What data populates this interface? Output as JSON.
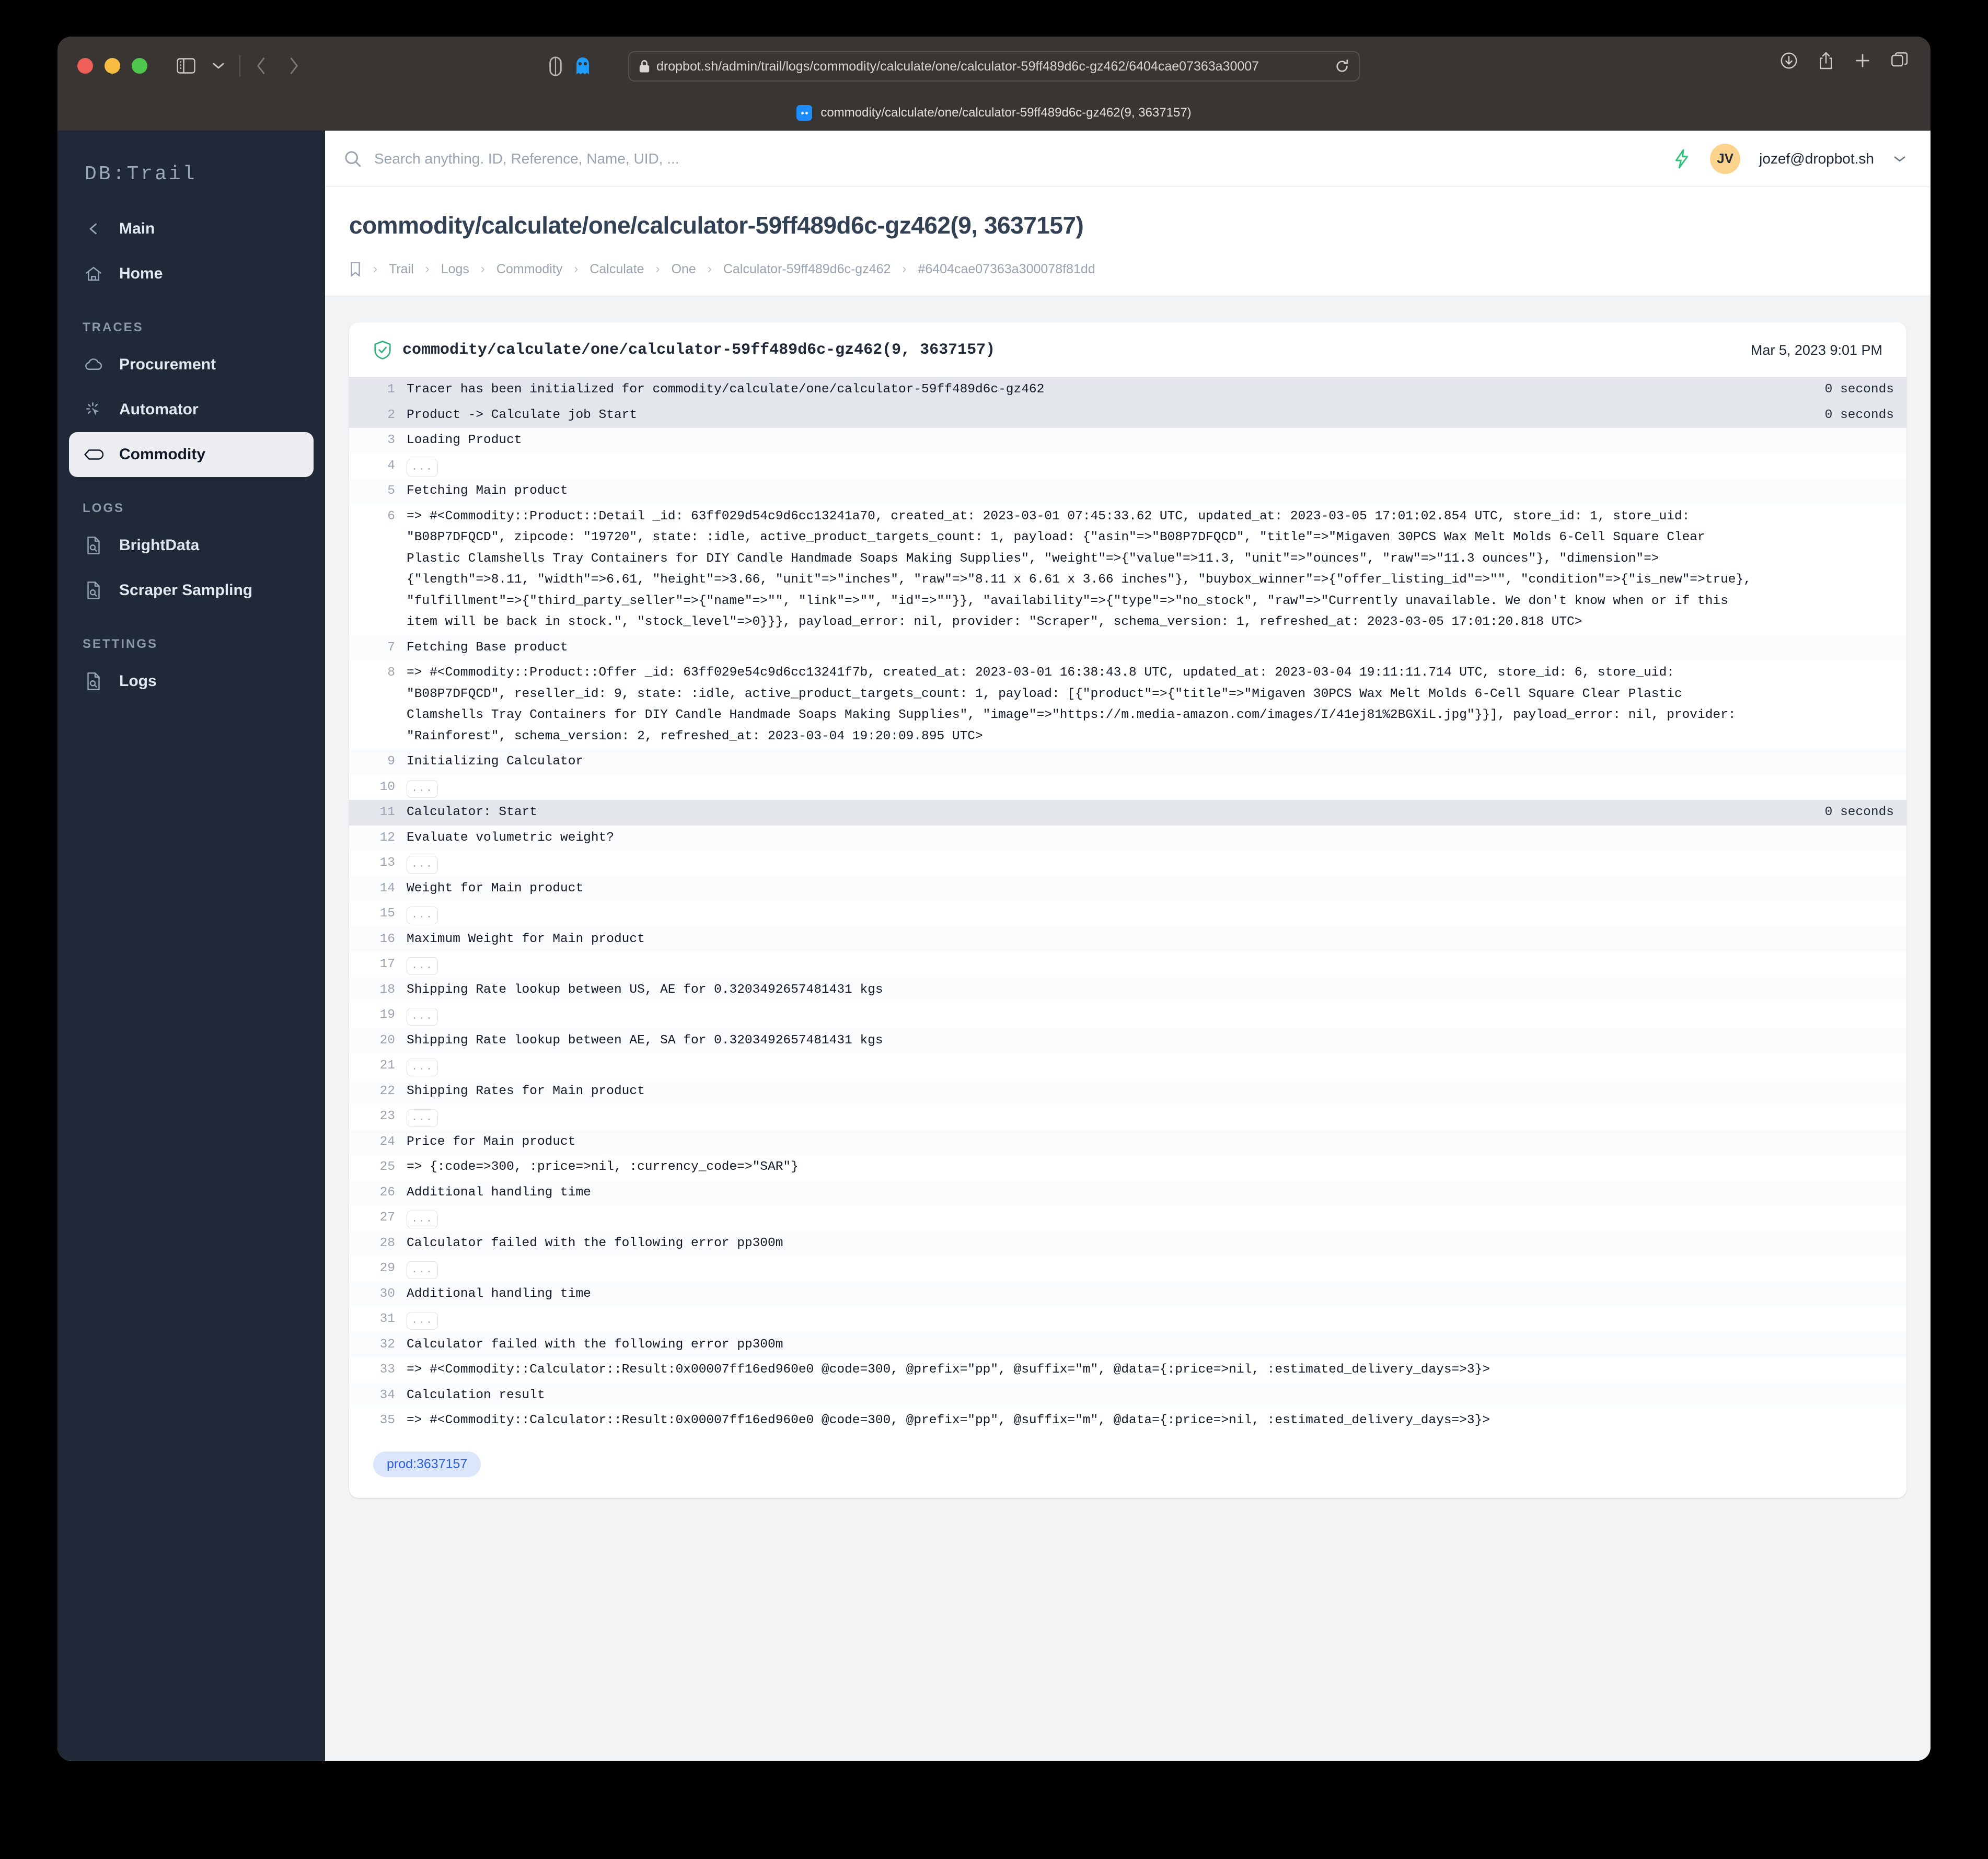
{
  "browser": {
    "url": "dropbot.sh/admin/trail/logs/commodity/calculate/one/calculator-59ff489d6c-gz462/6404cae07363a30007",
    "tab_title": "commodity/calculate/one/calculator-59ff489d6c-gz462(9, 3637157)"
  },
  "sidebar": {
    "brand": "DB:Trail",
    "top_items": [
      {
        "label": "Main",
        "icon": "chevron-left-icon"
      },
      {
        "label": "Home",
        "icon": "home-icon"
      }
    ],
    "sections": [
      {
        "title": "TRACES",
        "items": [
          {
            "label": "Procurement",
            "icon": "cloud-icon",
            "active": false
          },
          {
            "label": "Automator",
            "icon": "cursor-click-icon",
            "active": false
          },
          {
            "label": "Commodity",
            "icon": "tag-icon",
            "active": true
          }
        ]
      },
      {
        "title": "LOGS",
        "items": [
          {
            "label": "BrightData",
            "icon": "document-search-icon",
            "active": false
          },
          {
            "label": "Scraper Sampling",
            "icon": "document-search-icon",
            "active": false
          }
        ]
      },
      {
        "title": "SETTINGS",
        "items": [
          {
            "label": "Logs",
            "icon": "document-search-icon",
            "active": false
          }
        ]
      }
    ]
  },
  "topbar": {
    "search_placeholder": "Search anything. ID, Reference, Name, UID, ...",
    "search_value": "",
    "user_initials": "JV",
    "user_email": "jozef@dropbot.sh"
  },
  "header": {
    "title": "commodity/calculate/one/calculator-59ff489d6c-gz462(9, 3637157)",
    "breadcrumb": [
      "Trail",
      "Logs",
      "Commodity",
      "Calculate",
      "One",
      "Calculator-59ff489d6c-gz462",
      "#6404cae07363a300078f81dd"
    ]
  },
  "card": {
    "title": "commodity/calculate/one/calculator-59ff489d6c-gz462(9, 3637157)",
    "date": "Mar 5, 2023 9:01 PM",
    "status_icon": "shield-check-icon",
    "tag": "prod:3637157",
    "lines": [
      {
        "n": "1",
        "text": "Tracer has been initialized for commodity/calculate/one/calculator-59ff489d6c-gz462",
        "dur": "0 seconds",
        "highlight": true
      },
      {
        "n": "2",
        "text": "Product -> Calculate job Start",
        "dur": "0 seconds",
        "highlight": true
      },
      {
        "n": "3",
        "text": "Loading Product",
        "dur": ""
      },
      {
        "n": "4",
        "text": "...",
        "dur": "",
        "collapsed": true
      },
      {
        "n": "5",
        "text": "Fetching Main product",
        "dur": ""
      },
      {
        "n": "6",
        "text": "=> #<Commodity::Product::Detail _id: 63ff029d54c9d6cc13241a70, created_at: 2023-03-01 07:45:33.62 UTC, updated_at: 2023-03-05 17:01:02.854 UTC, store_id: 1, store_uid: \"B08P7DFQCD\", zipcode: \"19720\", state: :idle, active_product_targets_count: 1, payload: {\"asin\"=>\"B08P7DFQCD\", \"title\"=>\"Migaven 30PCS Wax Melt Molds 6-Cell Square Clear Plastic Clamshells Tray Containers for DIY Candle Handmade Soaps Making Supplies\", \"weight\"=>{\"value\"=>11.3, \"unit\"=>\"ounces\", \"raw\"=>\"11.3 ounces\"}, \"dimension\"=>{\"length\"=>8.11, \"width\"=>6.61, \"height\"=>3.66, \"unit\"=>\"inches\", \"raw\"=>\"8.11 x 6.61 x 3.66 inches\"}, \"buybox_winner\"=>{\"offer_listing_id\"=>\"\", \"condition\"=>{\"is_new\"=>true}, \"fulfillment\"=>{\"third_party_seller\"=>{\"name\"=>\"\", \"link\"=>\"\", \"id\"=>\"\"}}, \"availability\"=>{\"type\"=>\"no_stock\", \"raw\"=>\"Currently unavailable. We don't know when or if this item will be back in stock.\", \"stock_level\"=>0}}}, payload_error: nil, provider: \"Scraper\", schema_version: 1, refreshed_at: 2023-03-05 17:01:20.818 UTC>",
        "dur": ""
      },
      {
        "n": "7",
        "text": "Fetching Base product",
        "dur": ""
      },
      {
        "n": "8",
        "text": "=> #<Commodity::Product::Offer _id: 63ff029e54c9d6cc13241f7b, created_at: 2023-03-01 16:38:43.8 UTC, updated_at: 2023-03-04 19:11:11.714 UTC, store_id: 6, store_uid: \"B08P7DFQCD\", reseller_id: 9, state: :idle, active_product_targets_count: 1, payload: [{\"product\"=>{\"title\"=>\"Migaven 30PCS Wax Melt Molds 6-Cell Square Clear Plastic Clamshells Tray Containers for DIY Candle Handmade Soaps Making Supplies\", \"image\"=>\"https://m.media-amazon.com/images/I/41ej81%2BGXiL.jpg\"}}], payload_error: nil, provider: \"Rainforest\", schema_version: 2, refreshed_at: 2023-03-04 19:20:09.895 UTC>",
        "dur": ""
      },
      {
        "n": "9",
        "text": "Initializing Calculator",
        "dur": ""
      },
      {
        "n": "10",
        "text": "...",
        "dur": "",
        "collapsed": true
      },
      {
        "n": "11",
        "text": "Calculator: Start",
        "dur": "0 seconds",
        "highlight": true
      },
      {
        "n": "12",
        "text": "Evaluate volumetric weight?",
        "dur": ""
      },
      {
        "n": "13",
        "text": "...",
        "dur": "",
        "collapsed": true
      },
      {
        "n": "14",
        "text": "Weight for Main product",
        "dur": ""
      },
      {
        "n": "15",
        "text": "...",
        "dur": "",
        "collapsed": true
      },
      {
        "n": "16",
        "text": "Maximum Weight for Main product",
        "dur": ""
      },
      {
        "n": "17",
        "text": "...",
        "dur": "",
        "collapsed": true
      },
      {
        "n": "18",
        "text": "Shipping Rate lookup between US, AE for 0.3203492657481431 kgs",
        "dur": ""
      },
      {
        "n": "19",
        "text": "...",
        "dur": "",
        "collapsed": true
      },
      {
        "n": "20",
        "text": "Shipping Rate lookup between AE, SA for 0.3203492657481431 kgs",
        "dur": ""
      },
      {
        "n": "21",
        "text": "...",
        "dur": "",
        "collapsed": true
      },
      {
        "n": "22",
        "text": "Shipping Rates for Main product",
        "dur": ""
      },
      {
        "n": "23",
        "text": "...",
        "dur": "",
        "collapsed": true
      },
      {
        "n": "24",
        "text": "Price for Main product",
        "dur": ""
      },
      {
        "n": "25",
        "text": "=> {:code=>300, :price=>nil, :currency_code=>\"SAR\"}",
        "dur": ""
      },
      {
        "n": "26",
        "text": "Additional handling time",
        "dur": ""
      },
      {
        "n": "27",
        "text": "...",
        "dur": "",
        "collapsed": true
      },
      {
        "n": "28",
        "text": "Calculator failed with the following error pp300m",
        "dur": ""
      },
      {
        "n": "29",
        "text": "...",
        "dur": "",
        "collapsed": true
      },
      {
        "n": "30",
        "text": "Additional handling time",
        "dur": ""
      },
      {
        "n": "31",
        "text": "...",
        "dur": "",
        "collapsed": true
      },
      {
        "n": "32",
        "text": "Calculator failed with the following error pp300m",
        "dur": ""
      },
      {
        "n": "33",
        "text": "=> #<Commodity::Calculator::Result:0x00007ff16ed960e0 @code=300, @prefix=\"pp\", @suffix=\"m\", @data={:price=>nil, :estimated_delivery_days=>3}>",
        "dur": ""
      },
      {
        "n": "34",
        "text": "Calculation result",
        "dur": ""
      },
      {
        "n": "35",
        "text": "=> #<Commodity::Calculator::Result:0x00007ff16ed960e0 @code=300, @prefix=\"pp\", @suffix=\"m\", @data={:price=>nil, :estimated_delivery_days=>3}>",
        "dur": ""
      }
    ]
  },
  "colors": {
    "sidebar_bg": "#1f2937",
    "accent_green": "#34c37d",
    "tag_bg": "#dbe6fb",
    "tag_fg": "#2b5fd9",
    "avatar_bg": "#fbd38d"
  }
}
